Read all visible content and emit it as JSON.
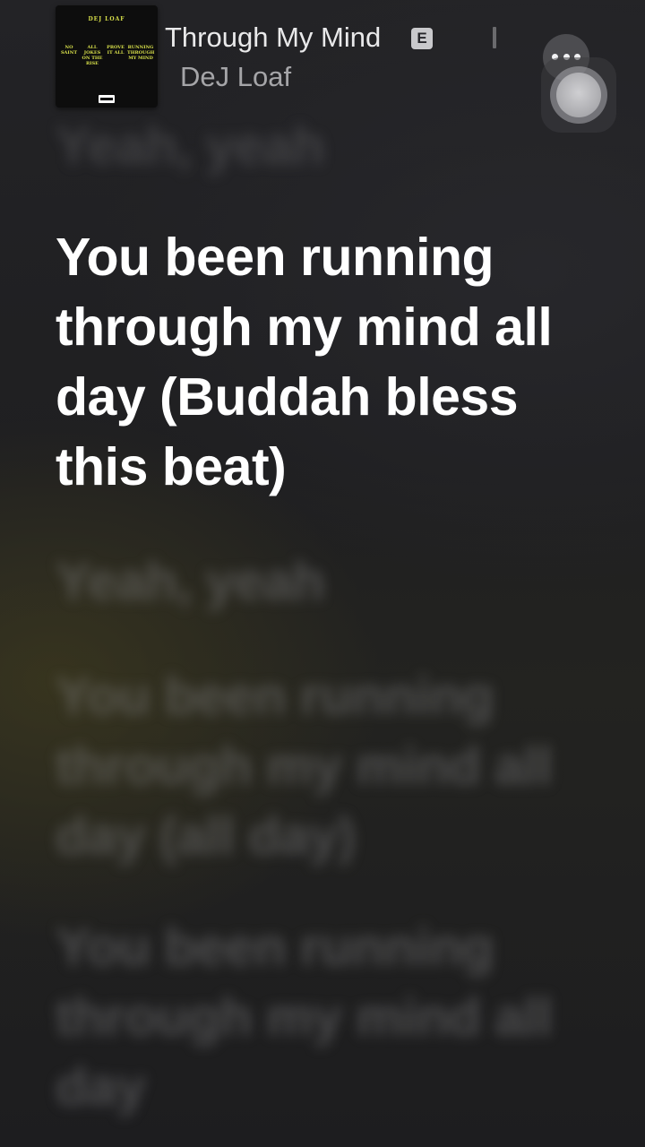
{
  "now_playing": {
    "title": "Through My Mind",
    "explicit_badge": "E",
    "artist": "DeJ Loaf",
    "album_art": {
      "brand": "DEJ LOAF",
      "tags": [
        "NO SAINT",
        "ALL JOKES ON THE RISE",
        "PROVE IT ALL",
        "RUNNING THROUGH MY MIND"
      ]
    },
    "icons": {
      "more": "more-horizontal-icon",
      "assistive_touch": "assistive-touch-icon"
    }
  },
  "lyrics": [
    {
      "text": "Yeah, yeah",
      "state": "past"
    },
    {
      "text": "You been running through my mind all day (Buddah bless this beat)",
      "state": "current"
    },
    {
      "text": "Yeah, yeah",
      "state": "upcoming"
    },
    {
      "text": "You been running through my mind all day (all day)",
      "state": "upcoming"
    },
    {
      "text": "You been running through my mind all day",
      "state": "upcoming"
    }
  ],
  "colors": {
    "background": "#1c1c1e",
    "current_lyric": "#ffffff",
    "title": "#e9e9ea",
    "artist": "#a5a5a8"
  }
}
